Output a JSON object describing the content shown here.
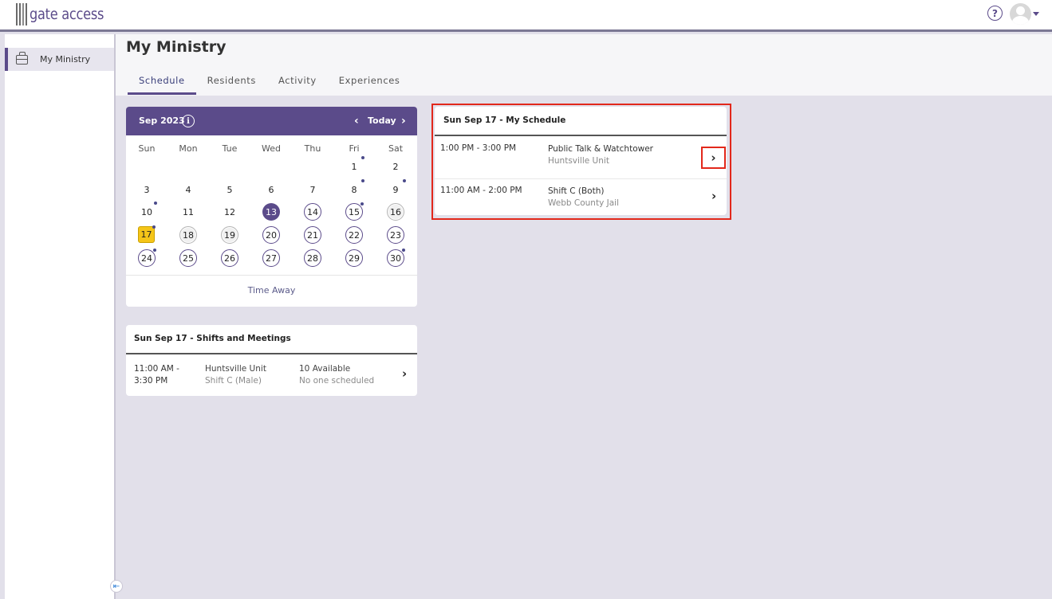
{
  "app": {
    "logo_text": "gate access"
  },
  "header": {
    "help_icon": "help-icon",
    "avatar_icon": "user-avatar-icon"
  },
  "sidebar": {
    "items": [
      {
        "label": "My Ministry",
        "icon": "briefcase-icon"
      }
    ]
  },
  "page": {
    "title": "My Ministry",
    "tabs": [
      {
        "label": "Schedule",
        "active": true
      },
      {
        "label": "Residents"
      },
      {
        "label": "Activity"
      },
      {
        "label": "Experiences"
      }
    ]
  },
  "calendar": {
    "month_label": "Sep 2023",
    "today_label": "Today",
    "weekdays": [
      "Sun",
      "Mon",
      "Tue",
      "Wed",
      "Thu",
      "Fri",
      "Sat"
    ],
    "time_away_label": "Time Away",
    "days": [
      {
        "d": "1",
        "s": "",
        "dot": true
      },
      {
        "d": "2",
        "s": "",
        "dot": false
      },
      {
        "d": "3",
        "s": "",
        "dot": false
      },
      {
        "d": "4",
        "s": "",
        "dot": false
      },
      {
        "d": "5",
        "s": "",
        "dot": false
      },
      {
        "d": "6",
        "s": "",
        "dot": false
      },
      {
        "d": "7",
        "s": "",
        "dot": false
      },
      {
        "d": "8",
        "s": "",
        "dot": true
      },
      {
        "d": "9",
        "s": "",
        "dot": true
      },
      {
        "d": "10",
        "s": "",
        "dot": true
      },
      {
        "d": "11",
        "s": "",
        "dot": false
      },
      {
        "d": "12",
        "s": "",
        "dot": false
      },
      {
        "d": "13",
        "s": "selected",
        "dot": false
      },
      {
        "d": "14",
        "s": "outline",
        "dot": false
      },
      {
        "d": "15",
        "s": "outline",
        "dot": true
      },
      {
        "d": "16",
        "s": "grey",
        "dot": false
      },
      {
        "d": "17",
        "s": "today",
        "dot": true
      },
      {
        "d": "18",
        "s": "grey",
        "dot": false
      },
      {
        "d": "19",
        "s": "grey",
        "dot": false
      },
      {
        "d": "20",
        "s": "outline",
        "dot": false
      },
      {
        "d": "21",
        "s": "outline",
        "dot": false
      },
      {
        "d": "22",
        "s": "outline",
        "dot": false
      },
      {
        "d": "23",
        "s": "outline",
        "dot": false
      },
      {
        "d": "24",
        "s": "outline",
        "dot": true
      },
      {
        "d": "25",
        "s": "outline",
        "dot": false
      },
      {
        "d": "26",
        "s": "outline",
        "dot": false
      },
      {
        "d": "27",
        "s": "outline",
        "dot": false
      },
      {
        "d": "28",
        "s": "outline",
        "dot": false
      },
      {
        "d": "29",
        "s": "outline",
        "dot": false
      },
      {
        "d": "30",
        "s": "outline",
        "dot": true
      }
    ]
  },
  "shifts": {
    "title": "Sun Sep 17 - Shifts and Meetings",
    "rows": [
      {
        "time": "11:00 AM - 3:30 PM",
        "location": "Huntsville Unit",
        "shift": "Shift C (Male)",
        "available": "10 Available",
        "scheduled": "No one scheduled"
      }
    ]
  },
  "my_schedule": {
    "title": "Sun Sep 17 - My Schedule",
    "rows": [
      {
        "time": "1:00 PM - 3:00 PM",
        "name": "Public Talk & Watchtower",
        "location": "Huntsville Unit"
      },
      {
        "time": "11:00 AM - 2:00 PM",
        "name": "Shift C (Both)",
        "location": "Webb County Jail"
      }
    ]
  },
  "colors": {
    "accent": "#5b4b8a",
    "highlight": "#e2281b",
    "today": "#f5c518",
    "background": "#e2e0ea"
  }
}
